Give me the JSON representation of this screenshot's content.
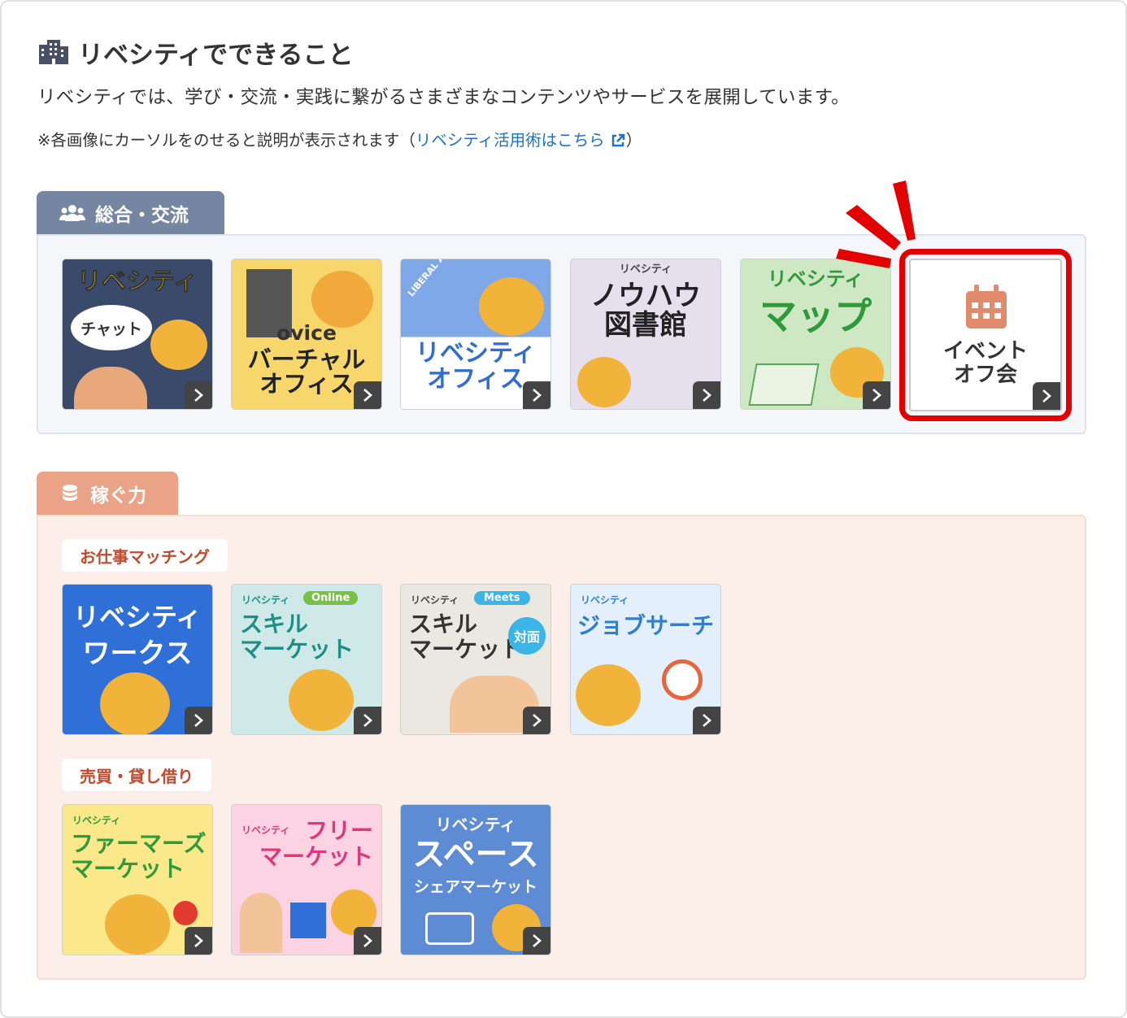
{
  "header": {
    "title": "リベシティでできること",
    "lead": "リベシティでは、学び・交流・実践に繋がるさまざまなコンテンツやサービスを展開しています。",
    "note_prefix": "※各画像にカーソルをのせると説明が表示されます（",
    "note_link": "リベシティ活用術はこちら",
    "note_suffix": "）"
  },
  "sections": {
    "general": {
      "tab_label": "総合・交流",
      "tiles": [
        {
          "main": "リベシティ",
          "sub": "チャット"
        },
        {
          "main": "ovice",
          "sub": "バーチャル\nオフィス"
        },
        {
          "main": "LIBERAL ARTS CITY",
          "sub": "リベシティ\nオフィス"
        },
        {
          "main": "リベシティ",
          "sub": "ノウハウ\n図書館"
        },
        {
          "main": "リベシティ",
          "sub": "マップ"
        },
        {
          "main": "イベント\nオフ会"
        }
      ]
    },
    "earn": {
      "tab_label": "稼ぐ力",
      "groups": [
        {
          "label": "お仕事マッチング",
          "tiles": [
            {
              "main": "リベシティ",
              "sub": "ワークス"
            },
            {
              "main": "リベシティ",
              "badge": "Online",
              "sub": "スキル\nマーケット"
            },
            {
              "main": "リベシティ",
              "badge": "Meets",
              "sub": "スキル\nマーケット",
              "extra": "対面"
            },
            {
              "main": "リベシティ",
              "sub": "ジョブサーチ"
            }
          ]
        },
        {
          "label": "売買・貸し借り",
          "tiles": [
            {
              "main": "リベシティ",
              "sub": "ファーマーズ\nマーケット"
            },
            {
              "main": "リベシティ",
              "sub": "フリー\nマーケット"
            },
            {
              "main": "リベシティ",
              "sub": "スペース",
              "extra": "シェアマーケット"
            }
          ]
        }
      ]
    }
  },
  "icons": {
    "title": "building-icon",
    "general_tab": "users-icon",
    "earn_tab": "coins-icon",
    "external": "external-link-icon",
    "event": "calendar-icon",
    "tile_arrow": "chevron-right-icon"
  },
  "colors": {
    "link": "#1a73c8",
    "general_tab": "#7486a2",
    "earn_tab": "#eba387",
    "chip_text": "#c2492b",
    "highlight": "#e20000"
  }
}
